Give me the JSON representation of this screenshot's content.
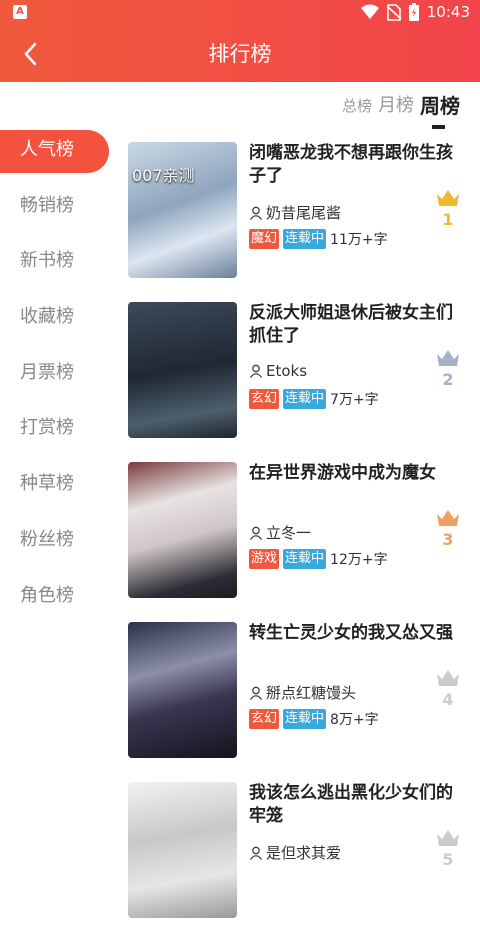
{
  "status": {
    "time": "10:43"
  },
  "header": {
    "title": "排行榜"
  },
  "rank_tabs": [
    {
      "label": "总榜"
    },
    {
      "label": "月榜"
    },
    {
      "label": "周榜"
    }
  ],
  "sidebar": {
    "items": [
      {
        "label": "人气榜"
      },
      {
        "label": "畅销榜"
      },
      {
        "label": "新书榜"
      },
      {
        "label": "收藏榜"
      },
      {
        "label": "月票榜"
      },
      {
        "label": "打赏榜"
      },
      {
        "label": "种草榜"
      },
      {
        "label": "粉丝榜"
      },
      {
        "label": "角色榜"
      }
    ]
  },
  "books": [
    {
      "title": "闭嘴恶龙我不想再跟你生孩子了",
      "author": "奶昔尾尾酱",
      "genre": "魔幻",
      "status": "连载中",
      "words": "11万+字",
      "rank": "1",
      "cover_text": "007亲测",
      "crown_color": "#f2b832"
    },
    {
      "title": "反派大师姐退休后被女主们抓住了",
      "author": "Etoks",
      "genre": "玄幻",
      "status": "连载中",
      "words": "7万+字",
      "rank": "2",
      "cover_text": "",
      "crown_color": "#a8afc8"
    },
    {
      "title": "在异世界游戏中成为魔女",
      "author": "立冬一",
      "genre": "游戏",
      "status": "连载中",
      "words": "12万+字",
      "rank": "3",
      "cover_text": "",
      "crown_color": "#f0a060"
    },
    {
      "title": "转生亡灵少女的我又怂又强",
      "author": "掰点红糖馒头",
      "genre": "玄幻",
      "status": "连载中",
      "words": "8万+字",
      "rank": "4",
      "cover_text": "",
      "crown_color": "#cccccc"
    },
    {
      "title": "我该怎么逃出黑化少女们的牢笼",
      "author": "是但求其爱",
      "genre": "",
      "status": "",
      "words": "",
      "rank": "5",
      "cover_text": "",
      "crown_color": "#cccccc"
    }
  ]
}
